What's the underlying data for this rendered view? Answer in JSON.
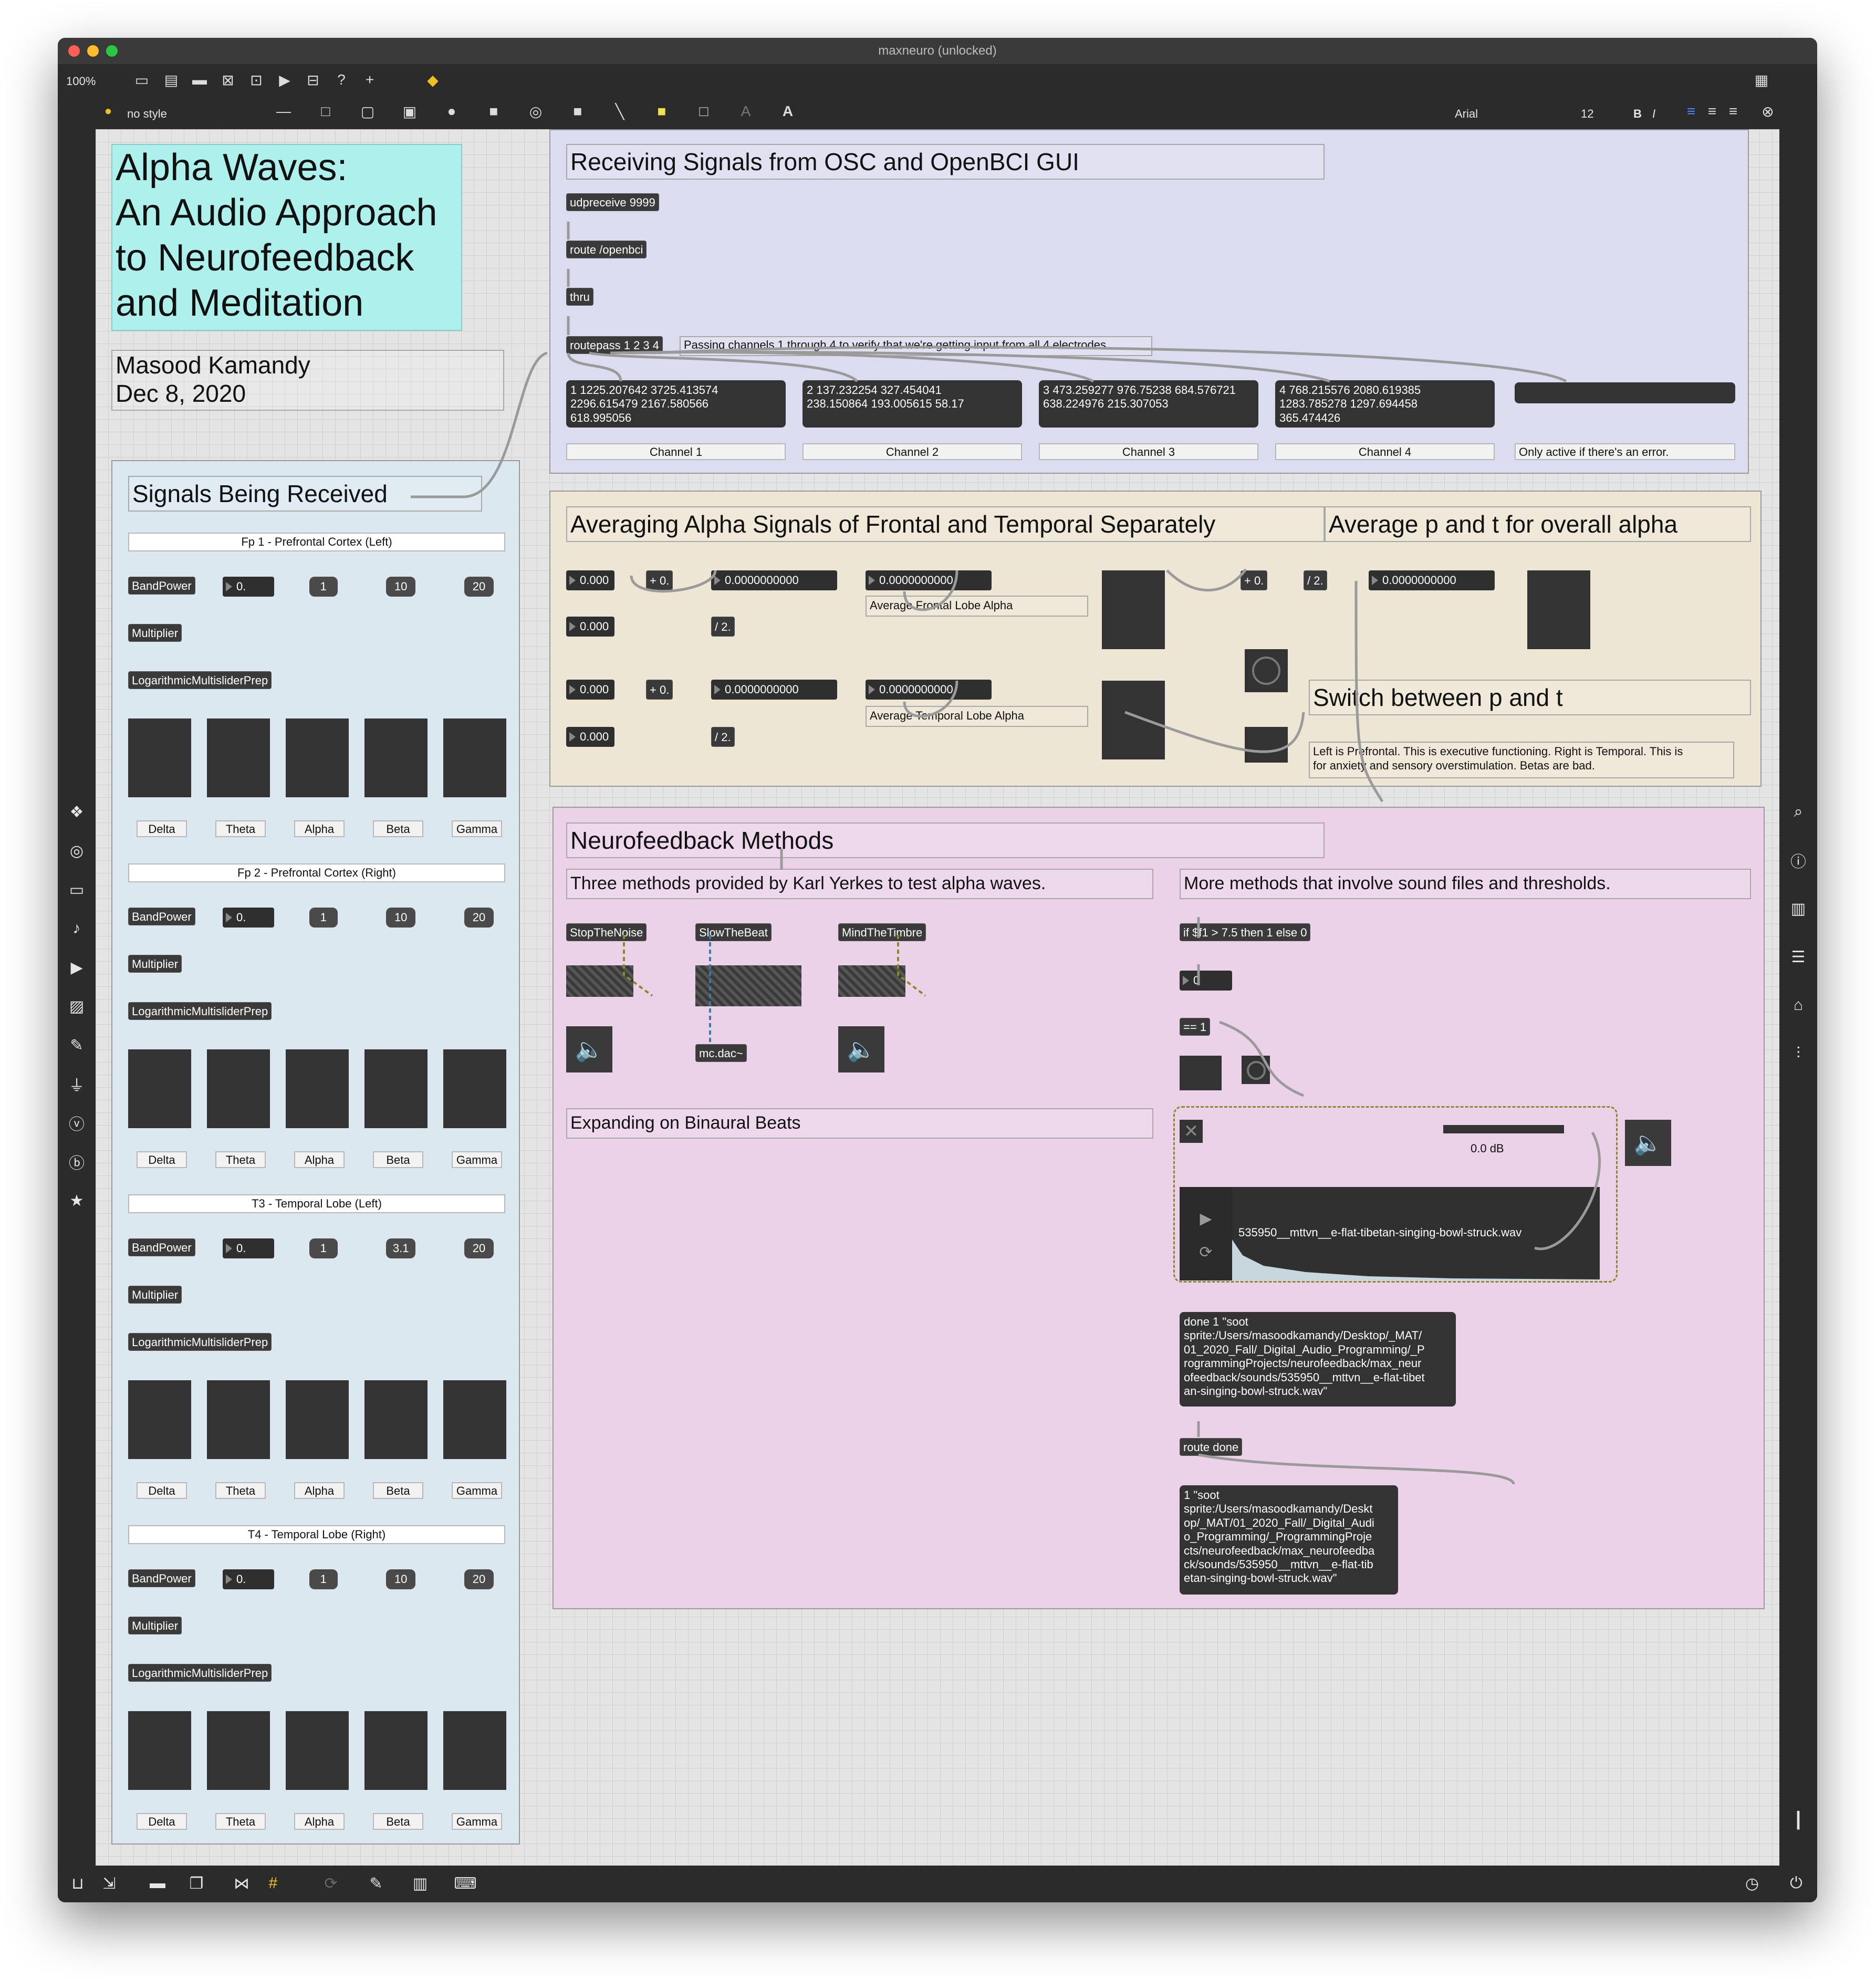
{
  "window": {
    "title": "maxneuro (unlocked)"
  },
  "toolbar": {
    "zoom": "100%",
    "style": "no style",
    "font_name": "Arial",
    "font_size": "12",
    "bold": "B",
    "italic": "I",
    "text_tool": "A"
  },
  "title_comment": {
    "lines": "Alpha Waves:\nAn Audio Approach\nto Neurofeedback\nand Meditation"
  },
  "author": {
    "name": "Masood Kamandy",
    "date": "Dec 8, 2020"
  },
  "signals": {
    "header": "Signals Being Received",
    "groups": [
      {
        "title": "Fp 1 - Prefrontal Cortex (Left)",
        "bandpower": "BandPower",
        "num": "0.",
        "msgs": [
          "1",
          "10",
          "20"
        ],
        "multiplier": "Multiplier",
        "prep": "LogarithmicMultisliderPrep",
        "bands": [
          "Delta",
          "Theta",
          "Alpha",
          "Beta",
          "Gamma"
        ]
      },
      {
        "title": "Fp 2 - Prefrontal Cortex (Right)",
        "bandpower": "BandPower",
        "num": "0.",
        "msgs": [
          "1",
          "10",
          "20"
        ],
        "multiplier": "Multiplier",
        "prep": "LogarithmicMultisliderPrep",
        "bands": [
          "Delta",
          "Theta",
          "Alpha",
          "Beta",
          "Gamma"
        ]
      },
      {
        "title": "T3 - Temporal Lobe (Left)",
        "bandpower": "BandPower",
        "num": "0.",
        "msgs": [
          "1",
          "3.1",
          "20"
        ],
        "multiplier": "Multiplier",
        "prep": "LogarithmicMultisliderPrep",
        "bands": [
          "Delta",
          "Theta",
          "Alpha",
          "Beta",
          "Gamma"
        ]
      },
      {
        "title": "T4 - Temporal Lobe (Right)",
        "bandpower": "BandPower",
        "num": "0.",
        "msgs": [
          "1",
          "10",
          "20"
        ],
        "multiplier": "Multiplier",
        "prep": "LogarithmicMultisliderPrep",
        "bands": [
          "Delta",
          "Theta",
          "Alpha",
          "Beta",
          "Gamma"
        ]
      }
    ]
  },
  "osc": {
    "header": "Receiving Signals from OSC and OpenBCI GUI",
    "udp": "udpreceive 9999",
    "route": "route /openbci",
    "thru": "thru",
    "routepass": "routepass 1 2 3 4",
    "routepass_comment": "Passing channels 1 through 4 to verify that we're getting input from all 4 electrodes.",
    "channels": [
      {
        "msg": "1 1225.207642 3725.413574\n2296.615479 2167.580566\n618.995056",
        "label": "Channel 1"
      },
      {
        "msg": "2 137.232254 327.454041\n238.150864 193.005615 58.17",
        "label": "Channel 2"
      },
      {
        "msg": "3 473.259277 976.75238 684.576721\n638.224976 215.307053",
        "label": "Channel 3"
      },
      {
        "msg": "4 768.215576 2080.619385\n1283.785278 1297.694458\n365.474426",
        "label": "Channel 4"
      }
    ],
    "error_label": "Only active if there's an error."
  },
  "averaging": {
    "header": "Averaging Alpha Signals of Frontal and Temporal Separately",
    "header2": "Average p and t for overall alpha",
    "num_zero": "0.000",
    "plus": "+ 0.",
    "div": "/ 2.",
    "long_num": "0.0000000000",
    "frontal_label": "Average Frontal Lobe Alpha",
    "temporal_label": "Average Temporal Lobe Alpha",
    "switch_header": "Switch between p and t",
    "switch_comment": "Left is Prefrontal. This is executive functioning. Right is Temporal. This is\nfor anxiety and sensory overstimulation. Betas are bad."
  },
  "neuro": {
    "header": "Neurofeedback Methods",
    "sub1": "Three methods provided by Karl Yerkes to test alpha waves.",
    "sub2": "More methods that involve sound files and thresholds.",
    "methods": [
      "StopTheNoise",
      "SlowTheBeat",
      "MindTheTimbre"
    ],
    "dac": "mc.dac~",
    "binaural": "Expanding on Binaural Beats",
    "expr": "if $f1 > 7.5 then 1 else 0",
    "int_num": "0",
    "eq": "== 1",
    "gain": "0.0 dB",
    "file": "535950__mttvn__e-flat-tibetan-singing-bowl-struck.wav",
    "done_msg": "done 1 \"soot\nsprite:/Users/masoodkamandy/Desktop/_MAT/\n01_2020_Fall/_Digital_Audio_Programming/_P\nrogrammingProjects/neurofeedback/max_neur\nofeedback/sounds/535950__mttvn__e-flat-tibet\nan-singing-bowl-struck.wav\"",
    "route_done": "route done",
    "result_msg": "1 \"soot\nsprite:/Users/masoodkamandy/Deskt\nop/_MAT/01_2020_Fall/_Digital_Audi\no_Programming/_ProgrammingProje\ncts/neurofeedback/max_neurofeedba\nck/sounds/535950__mttvn__e-flat-tib\netan-singing-bowl-struck.wav\""
  },
  "colors": {
    "osc_panel": "#dcdcf0",
    "avg_panel": "#eee6d4",
    "neuro_panel": "#ebd2e8",
    "signals_panel": "#dbe8f0",
    "title_box": "#aef0ec",
    "object_bg": "#3a3a3a"
  }
}
